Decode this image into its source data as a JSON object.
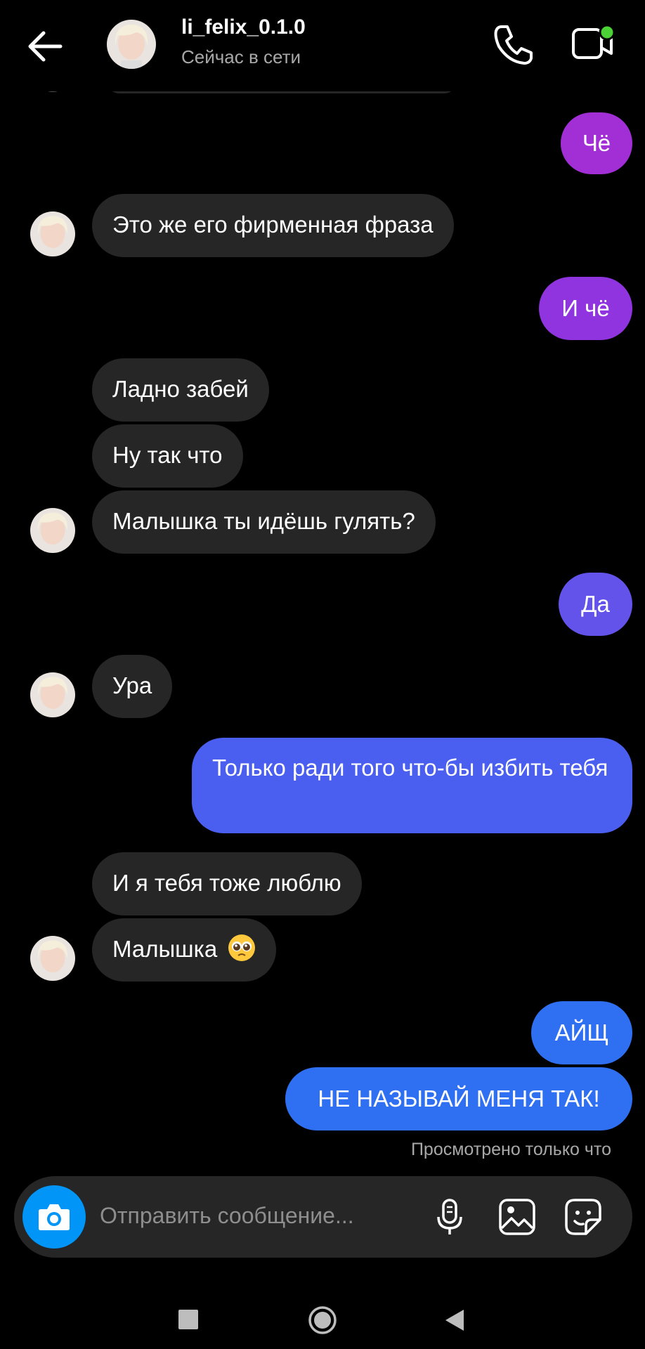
{
  "header": {
    "username": "li_felix_0.1.0",
    "status": "Сейчас в сети",
    "icons": {
      "back": "arrow-left-icon",
      "call": "phone-icon",
      "video": "video-camera-icon"
    },
    "online_dot_color": "#4cd137"
  },
  "messages": [
    {
      "side": "out",
      "text": "Чё"
    },
    {
      "side": "in",
      "text": "Это же его фирменная фраза"
    },
    {
      "side": "out",
      "text": "И чё"
    },
    {
      "side": "in",
      "text": "Ладно забей"
    },
    {
      "side": "in",
      "text": "Ну так что"
    },
    {
      "side": "in",
      "text": "Малышка ты идёшь гулять?"
    },
    {
      "side": "out",
      "text": "Да"
    },
    {
      "side": "in",
      "text": "Ура"
    },
    {
      "side": "out",
      "text": "Только ради того что-бы избить тебя"
    },
    {
      "side": "in",
      "text": "И я тебя тоже люблю"
    },
    {
      "side": "in",
      "text": "Малышка",
      "emoji": "pleading-face"
    },
    {
      "side": "out",
      "text": "АЙЩ"
    },
    {
      "side": "out",
      "text": "НЕ НАЗЫВАЙ МЕНЯ ТАК!"
    }
  ],
  "seen_status": "Просмотрено только что",
  "composer": {
    "placeholder": "Отправить сообщение...",
    "icons": [
      "camera-icon",
      "microphone-icon",
      "gallery-icon",
      "sticker-icon"
    ],
    "camera_button_color": "#0095f6"
  },
  "colors": {
    "incoming_bubble": "#262626",
    "outgoing_gradient": [
      "#a22fd6",
      "#7b3ce8",
      "#6353ea",
      "#4a5ff0",
      "#2f6ff2"
    ]
  },
  "navbar": {
    "icons": [
      "recent-apps-icon",
      "home-icon",
      "back-icon"
    ]
  }
}
